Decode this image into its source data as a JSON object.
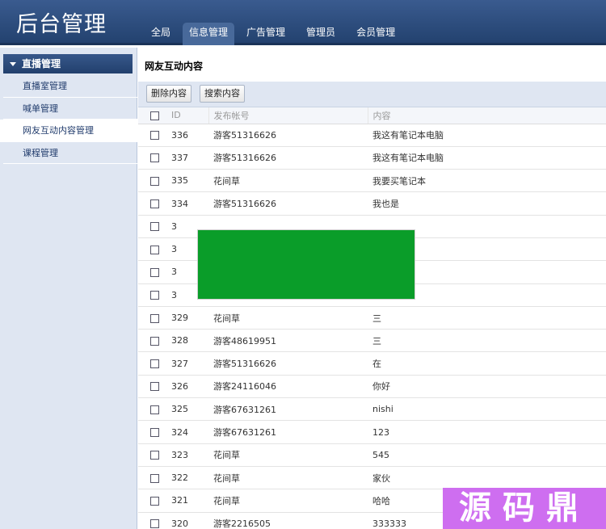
{
  "header": {
    "title": "后台管理",
    "nav": [
      {
        "label": "全局"
      },
      {
        "label": "信息管理"
      },
      {
        "label": "广告管理"
      },
      {
        "label": "管理员"
      },
      {
        "label": "会员管理"
      }
    ],
    "active_nav": 1
  },
  "sidebar": {
    "heading": "直播管理",
    "items": [
      {
        "label": "直播室管理"
      },
      {
        "label": "喊单管理"
      },
      {
        "label": "网友互动内容管理"
      },
      {
        "label": "课程管理"
      }
    ],
    "active_item": 2
  },
  "main": {
    "title": "网友互动内容",
    "toolbar": {
      "delete_label": "删除内容",
      "search_label": "搜索内容"
    },
    "table": {
      "headers": {
        "id": "ID",
        "account": "发布帐号",
        "content": "内容"
      },
      "rows": [
        {
          "id": "336",
          "account": "游客51316626",
          "content": "我这有笔记本电脑"
        },
        {
          "id": "337",
          "account": "游客51316626",
          "content": "我这有笔记本电脑"
        },
        {
          "id": "335",
          "account": "花间草",
          "content": "我要买笔记本"
        },
        {
          "id": "334",
          "account": "游客51316626",
          "content": "我也是"
        },
        {
          "id": "3",
          "account": "",
          "content": ""
        },
        {
          "id": "3",
          "account": "",
          "content": ""
        },
        {
          "id": "3",
          "account": "",
          "content": ""
        },
        {
          "id": "3",
          "account": "",
          "content": ""
        },
        {
          "id": "329",
          "account": "花间草",
          "content": "三"
        },
        {
          "id": "328",
          "account": "游客48619951",
          "content": "三"
        },
        {
          "id": "327",
          "account": "游客51316626",
          "content": "在"
        },
        {
          "id": "326",
          "account": "游客24116046",
          "content": "你好"
        },
        {
          "id": "325",
          "account": "游客67631261",
          "content": "nishi"
        },
        {
          "id": "324",
          "account": "游客67631261",
          "content": "123"
        },
        {
          "id": "323",
          "account": "花间草",
          "content": "545"
        },
        {
          "id": "322",
          "account": "花间草",
          "content": "家伙"
        },
        {
          "id": "321",
          "account": "花间草",
          "content": "哈哈"
        },
        {
          "id": "320",
          "account": "游客2216505",
          "content": "333333"
        }
      ]
    }
  },
  "overlays": {
    "redaction_color": "#0a9d29",
    "watermark_text": "源码鼎",
    "watermark_color": "#ce6ef0"
  }
}
